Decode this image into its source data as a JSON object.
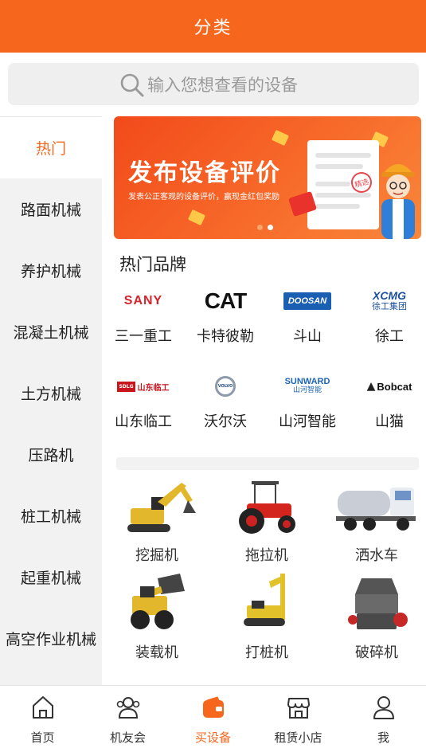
{
  "header": {
    "title": "分类"
  },
  "search": {
    "placeholder": "输入您想查看的设备",
    "icon": "search-icon"
  },
  "sidebar": {
    "items": [
      {
        "label": "热门",
        "active": true
      },
      {
        "label": "路面机械"
      },
      {
        "label": "养护机械"
      },
      {
        "label": "混凝土机械"
      },
      {
        "label": "土方机械"
      },
      {
        "label": "压路机"
      },
      {
        "label": "桩工机械"
      },
      {
        "label": "起重机械"
      },
      {
        "label": "高空作业机械"
      }
    ]
  },
  "banner": {
    "title": "发布设备评价",
    "subtitle": "发表公正客观的设备评价，赢现金红包奖励",
    "stamp": "精选"
  },
  "hot_brands": {
    "title": "热门品牌",
    "items": [
      {
        "name": "三一重工",
        "logo_text": "SANY",
        "logo_color": "#d8232a"
      },
      {
        "name": "卡特彼勒",
        "logo_text": "CAT",
        "logo_color": "#111111"
      },
      {
        "name": "斗山",
        "logo_text": "DOOSAN",
        "logo_color": "#1b5fb3"
      },
      {
        "name": "徐工",
        "logo_text": "XCMG",
        "logo_sub": "徐工集团",
        "logo_color": "#1d4fa0"
      },
      {
        "name": "山东临工",
        "logo_text": "山东临工",
        "logo_badge": "SDLG",
        "logo_color": "#c8161d"
      },
      {
        "name": "沃尔沃",
        "logo_text": "VOLVO",
        "logo_color": "#2a4f8a"
      },
      {
        "name": "山河智能",
        "logo_text": "SUNWARD",
        "logo_sub": "山河智能",
        "logo_color": "#1b64b8"
      },
      {
        "name": "山猫",
        "logo_text": "Bobcat",
        "logo_color": "#111111"
      }
    ]
  },
  "categories": [
    {
      "name": "挖掘机",
      "icon": "excavator-icon"
    },
    {
      "name": "拖拉机",
      "icon": "tractor-icon"
    },
    {
      "name": "洒水车",
      "icon": "water-truck-icon"
    },
    {
      "name": "装载机",
      "icon": "loader-icon"
    },
    {
      "name": "打桩机",
      "icon": "pile-driver-icon"
    },
    {
      "name": "破碎机",
      "icon": "crusher-icon"
    }
  ],
  "tabbar": {
    "items": [
      {
        "label": "首页",
        "icon": "home-icon"
      },
      {
        "label": "机友会",
        "icon": "users-icon"
      },
      {
        "label": "买设备",
        "icon": "wallet-icon",
        "active": true
      },
      {
        "label": "租赁小店",
        "icon": "store-icon"
      },
      {
        "label": "我",
        "icon": "person-icon"
      }
    ]
  },
  "colors": {
    "accent": "#f7661d",
    "sidebar_bg": "#f2f2f2"
  }
}
